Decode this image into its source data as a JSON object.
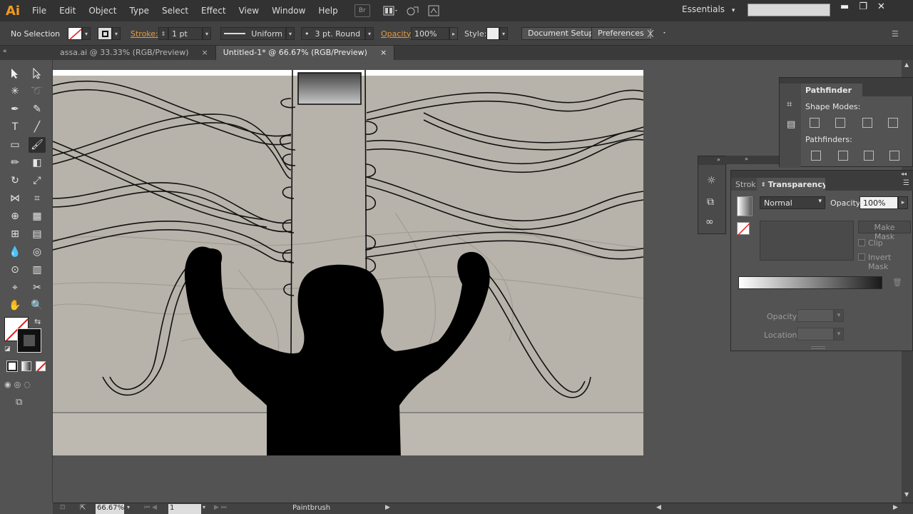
{
  "app": {
    "logo": "Ai"
  },
  "menu": [
    "File",
    "Edit",
    "Object",
    "Type",
    "Select",
    "Effect",
    "View",
    "Window",
    "Help"
  ],
  "menubar_icons": {
    "bridge": "Br"
  },
  "workspace": {
    "label": "Essentials",
    "arrow": "▾"
  },
  "search": {
    "placeholder": ""
  },
  "control": {
    "selection": "No Selection",
    "stroke_label": "Stroke:",
    "stroke_weight": "1 pt",
    "profile": "Uniform",
    "brush": "3 pt. Round",
    "brush_dot": "•",
    "opacity_label": "Opacity:",
    "opacity": "100%",
    "style_label": "Style:",
    "doc_setup": "Document Setup",
    "preferences": "Preferences"
  },
  "tabs": [
    {
      "label": "assa.ai @ 33.33% (RGB/Preview)",
      "close": "×"
    },
    {
      "label": "Untitled-1* @ 66.67% (RGB/Preview)",
      "close": "×"
    }
  ],
  "status": {
    "zoom": "66.67%",
    "artboard": "1",
    "tool": "Paintbrush"
  },
  "pathfinder": {
    "title": "Pathfinder",
    "shape_modes": "Shape Modes:",
    "pathfinders": "Pathfinders:"
  },
  "transparency": {
    "title": "Transparency",
    "other_tab": "Strok",
    "blend_mode": "Normal",
    "opacity_label": "Opacity:",
    "opacity": "100%",
    "make_mask": "Make Mask",
    "clip": "Clip",
    "invert_mask": "Invert Mask",
    "gradient_opacity_label": "Opacity:",
    "location_label": "Location:"
  },
  "colors": {
    "accent": "#f29b22",
    "stroke_label": "#e89a3c",
    "panel_bg": "#535353",
    "menubar_bg": "#323232",
    "artboard": "#b8b3aa"
  }
}
